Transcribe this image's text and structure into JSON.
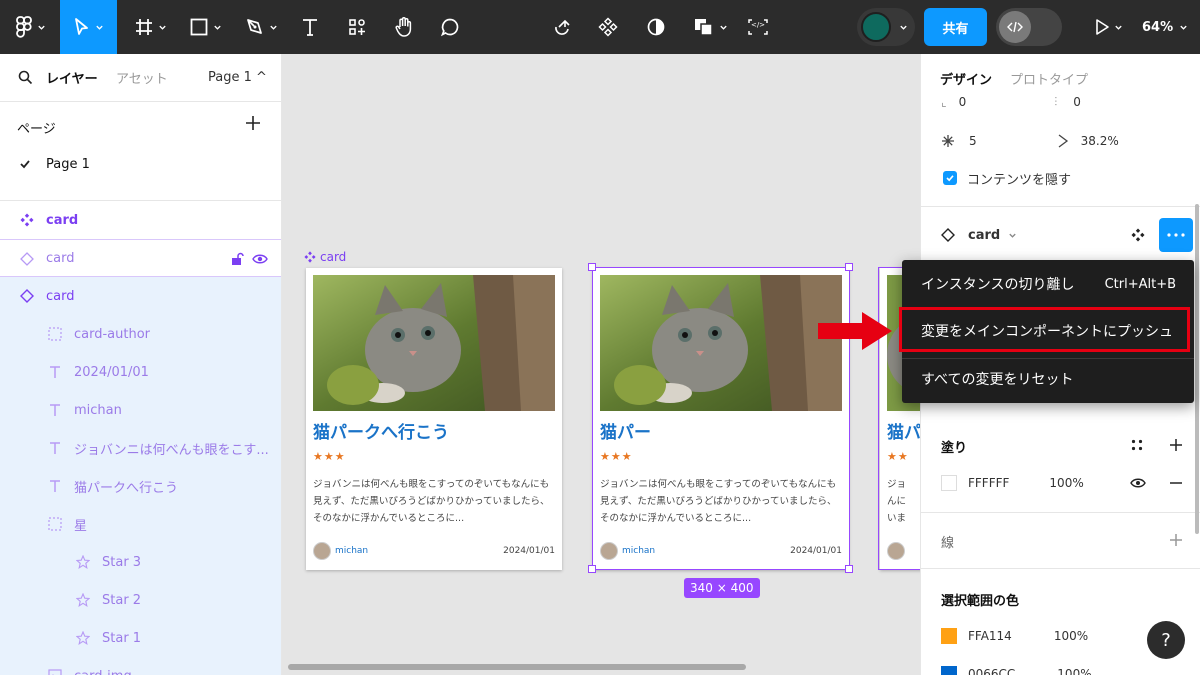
{
  "toolbar": {
    "share_label": "共有",
    "zoom": "64%"
  },
  "left_panel": {
    "tab_layers": "レイヤー",
    "tab_assets": "アセット",
    "page_selector": "Page 1 ^",
    "pages_header": "ページ",
    "pages": [
      {
        "label": "Page 1"
      }
    ],
    "layers": [
      {
        "label": "card"
      },
      {
        "label": "card"
      },
      {
        "label": "card"
      },
      {
        "label": "card-author"
      },
      {
        "label": "2024/01/01"
      },
      {
        "label": "michan"
      },
      {
        "label": "ジョバンニは何べんも眼をこす..."
      },
      {
        "label": "猫パークへ行こう"
      },
      {
        "label": "星"
      },
      {
        "label": "Star 3"
      },
      {
        "label": "Star 2"
      },
      {
        "label": "Star 1"
      },
      {
        "label": "card-img"
      }
    ]
  },
  "canvas": {
    "frame_label": "card",
    "size_badge": "340 × 400",
    "cards": [
      {
        "title": "猫パークへ行こう",
        "stars": "★★★",
        "body": "ジョバンニは何べんも眼をこすってのぞいてもなんにも見えず、ただ黒いびろうどばかりひかっていましたら、そのなかに浮かんでいるところに...",
        "author": "michan",
        "date": "2024/01/01"
      },
      {
        "title": "猫パー",
        "stars": "★★★",
        "body": "ジョバンニは何べんも眼をこすってのぞいてもなんにも見えず、ただ黒いびろうどばかりひかっていましたら、そのなかに浮かんでいるところに...",
        "author": "michan",
        "date": "2024/01/01"
      },
      {
        "title": "猫パ",
        "stars": "★★",
        "body": "ジョ んに いま",
        "author": "",
        "date": ""
      }
    ]
  },
  "right_panel": {
    "tab_design": "デザイン",
    "tab_prototype": "プロトタイプ",
    "corner_value_1": "0",
    "corner_value_2": "0",
    "count_value": "5",
    "ratio_value": "38.2%",
    "hide_content_label": "コンテンツを隠す",
    "instance_name": "card",
    "fill_title": "塗り",
    "fill_hex": "FFFFFF",
    "fill_opacity": "100%",
    "stroke_title": "線",
    "selection_colors_title": "選択範囲の色",
    "selection_colors": [
      {
        "hex": "FFA114",
        "opacity": "100%",
        "swatch": "#FFA114"
      },
      {
        "hex": "0066CC",
        "opacity": "100%",
        "swatch": "#0066CC"
      }
    ]
  },
  "context_menu": {
    "items": [
      {
        "label": "インスタンスの切り離し",
        "shortcut": "Ctrl+Alt+B"
      },
      {
        "label": "変更をメインコンポーネントにプッシュ",
        "shortcut": ""
      },
      {
        "label": "すべての変更をリセット",
        "shortcut": ""
      }
    ]
  },
  "colors": {
    "accent": "#0d99ff",
    "component_purple": "#9747ff",
    "highlight_red": "#e60012"
  }
}
